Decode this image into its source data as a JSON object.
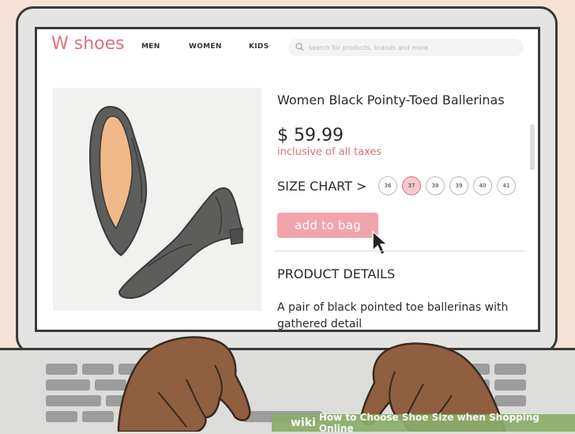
{
  "site": {
    "logo": "W shoes",
    "nav": [
      "MEN",
      "WOMEN",
      "KIDS"
    ],
    "search": {
      "placeholder": "search for products, brands and more",
      "icon": "search-icon"
    }
  },
  "product": {
    "title": "Women Black Pointy-Toed Ballerinas",
    "price": "$ 59.99",
    "tax_note": "inclusive of all taxes",
    "size_chart_label": "SIZE CHART >",
    "sizes": [
      "36",
      "37",
      "38",
      "39",
      "40",
      "41"
    ],
    "selected_size": "37",
    "add_to_bag": "add to bag",
    "details_heading": "PRODUCT DETAILS",
    "details_text": "A pair of black pointed toe ballerinas with gathered detail"
  },
  "caption": {
    "brand": "wiki",
    "text": "How to Choose Shoe Size when Shopping Online"
  },
  "colors": {
    "accent": "#d9727e",
    "button": "#f2a4ac",
    "selected_size": "#f6c9cd",
    "background": "#f6e2d6"
  }
}
